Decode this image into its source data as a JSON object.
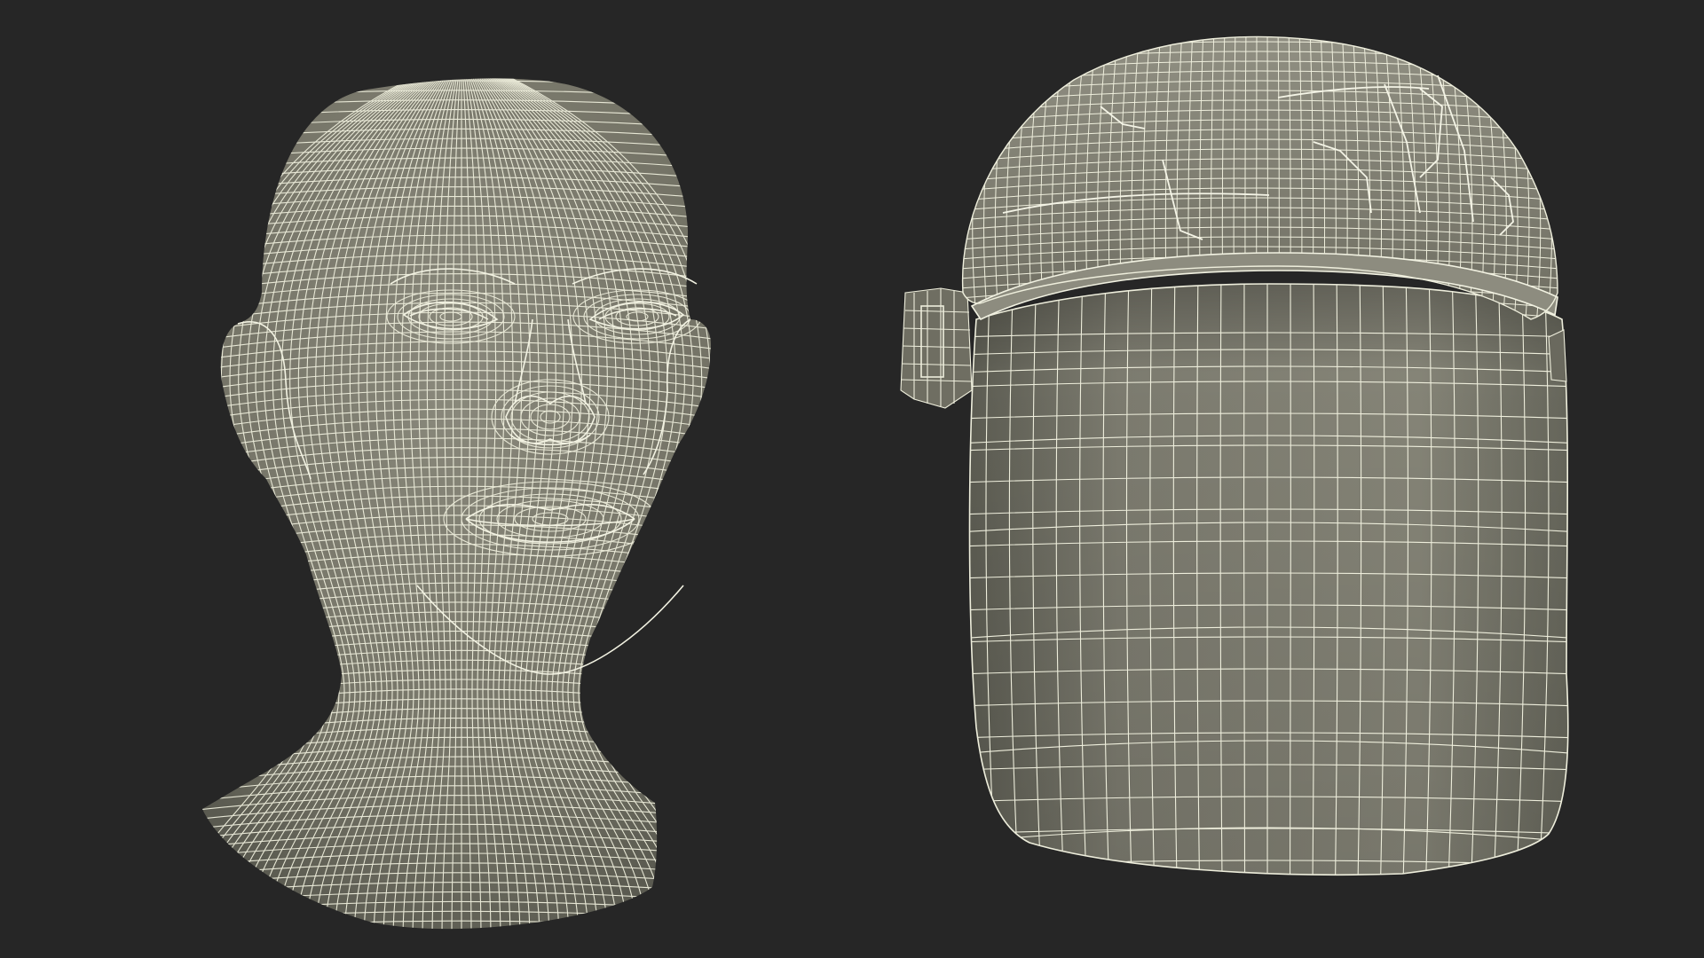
{
  "scene": {
    "background_color": "#262626",
    "surface_color": "#7d7c70",
    "wire_color": "#eeeedc",
    "objects": [
      {
        "name": "head-wireframe-model",
        "kind": "wireframe-head"
      },
      {
        "name": "face-shield-wireframe-model",
        "kind": "wireframe-face-shield"
      }
    ]
  }
}
